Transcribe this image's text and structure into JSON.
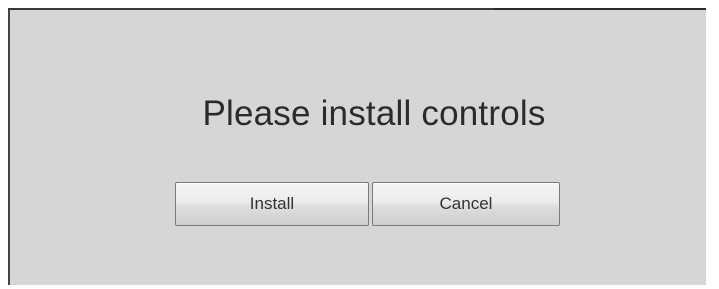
{
  "dialog": {
    "title": "Please install controls",
    "buttons": {
      "install_label": "Install",
      "cancel_label": "Cancel"
    }
  },
  "colors": {
    "dialog_background": "#d6d6d6",
    "page_background": "#ffffff",
    "frame_border": "#3a3a3a",
    "text": "#2b2b2b"
  }
}
